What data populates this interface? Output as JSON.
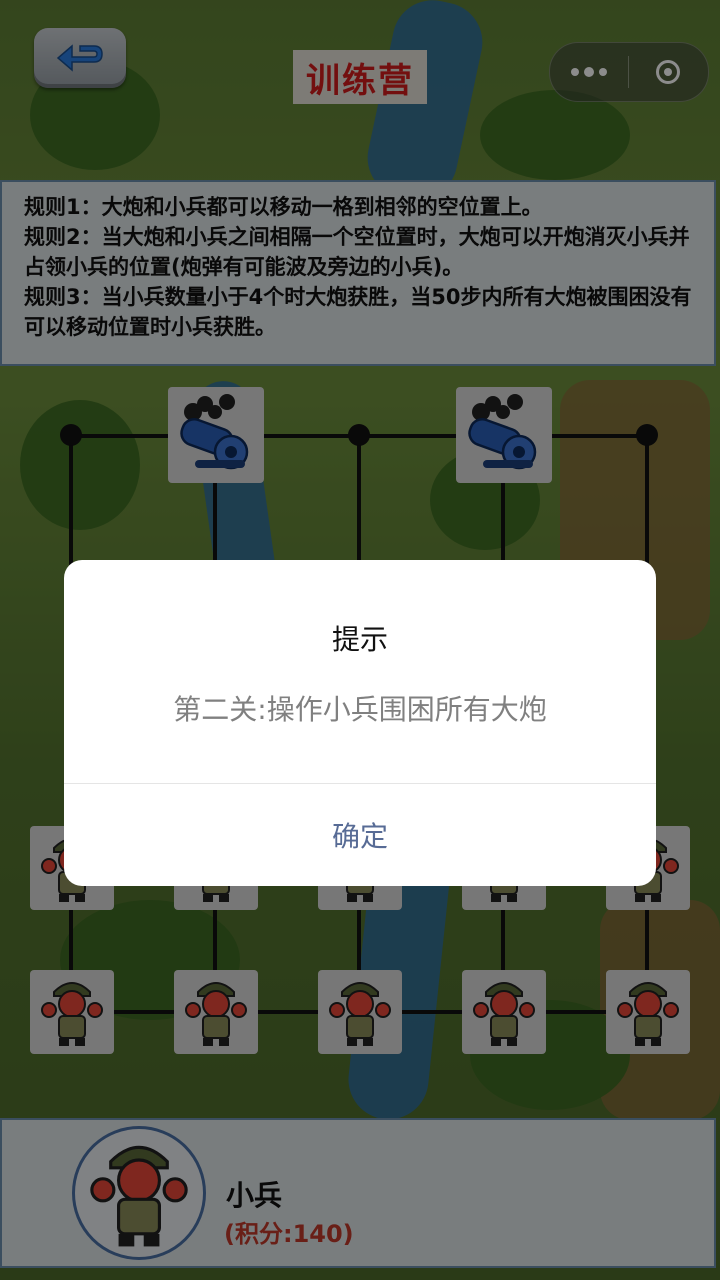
{
  "header": {
    "title": "训练营"
  },
  "rules": [
    "规则1：大炮和小兵都可以移动一格到相邻的空位置上。",
    "规则2：当大炮和小兵之间相隔一个空位置时，大炮可以开炮消灭小兵并占领小兵的位置(炮弹有可能波及旁边的小兵)。",
    "规则3：当小兵数量小于4个时大炮获胜，当50步内所有大炮被围困没有可以移动位置时小兵获胜。"
  ],
  "dialog": {
    "title": "提示",
    "content": "第二关:操作小兵围困所有大炮",
    "confirm_label": "确定"
  },
  "player": {
    "name": "小兵",
    "score": "(积分:140)"
  },
  "colors": {
    "title_text": "#d11d1d",
    "score_text": "#c0392b",
    "dialog_button": "#576b95"
  },
  "icons": {
    "back": "back-arrow-icon",
    "more": "more-dots-icon",
    "close": "close-circle-icon",
    "cannon": "cannon-icon",
    "soldier": "soldier-icon"
  }
}
